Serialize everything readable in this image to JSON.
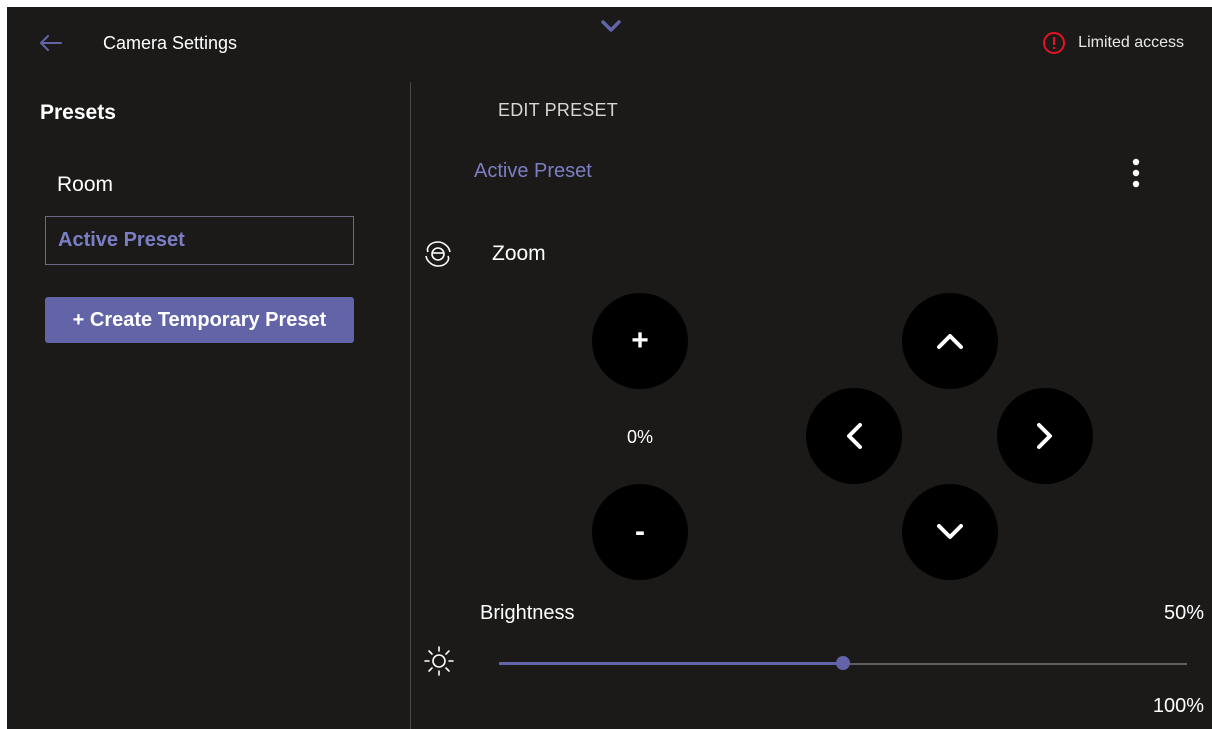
{
  "window": {
    "title": "Camera Settings",
    "status_text": "Limited access"
  },
  "sidebar": {
    "heading": "Presets",
    "items": [
      {
        "label": "Room",
        "selected": false
      },
      {
        "label": "Active Preset",
        "selected": true
      }
    ],
    "create_button_label": "+ Create Temporary Preset"
  },
  "main": {
    "section_heading": "EDIT PRESET",
    "preset_name": "Active Preset",
    "zoom": {
      "label": "Zoom",
      "value": "0%",
      "plus_label": "+",
      "minus_label": "-"
    },
    "brightness": {
      "label": "Brightness",
      "value_text": "50%",
      "level": 0.5,
      "max_text": "100%"
    }
  },
  "icons": {
    "back": "arrow-left-icon",
    "collapse": "chevron-down-icon",
    "status": "alert-circle-icon",
    "more": "more-vertical-icon",
    "zoom": "zoom-icon",
    "brightness": "sun-icon"
  },
  "colors": {
    "background": "#1b1a19",
    "accent": "#6264a7",
    "accent_text": "#7b7ec4",
    "alert": "#e81123",
    "button_bg": "#000000"
  }
}
